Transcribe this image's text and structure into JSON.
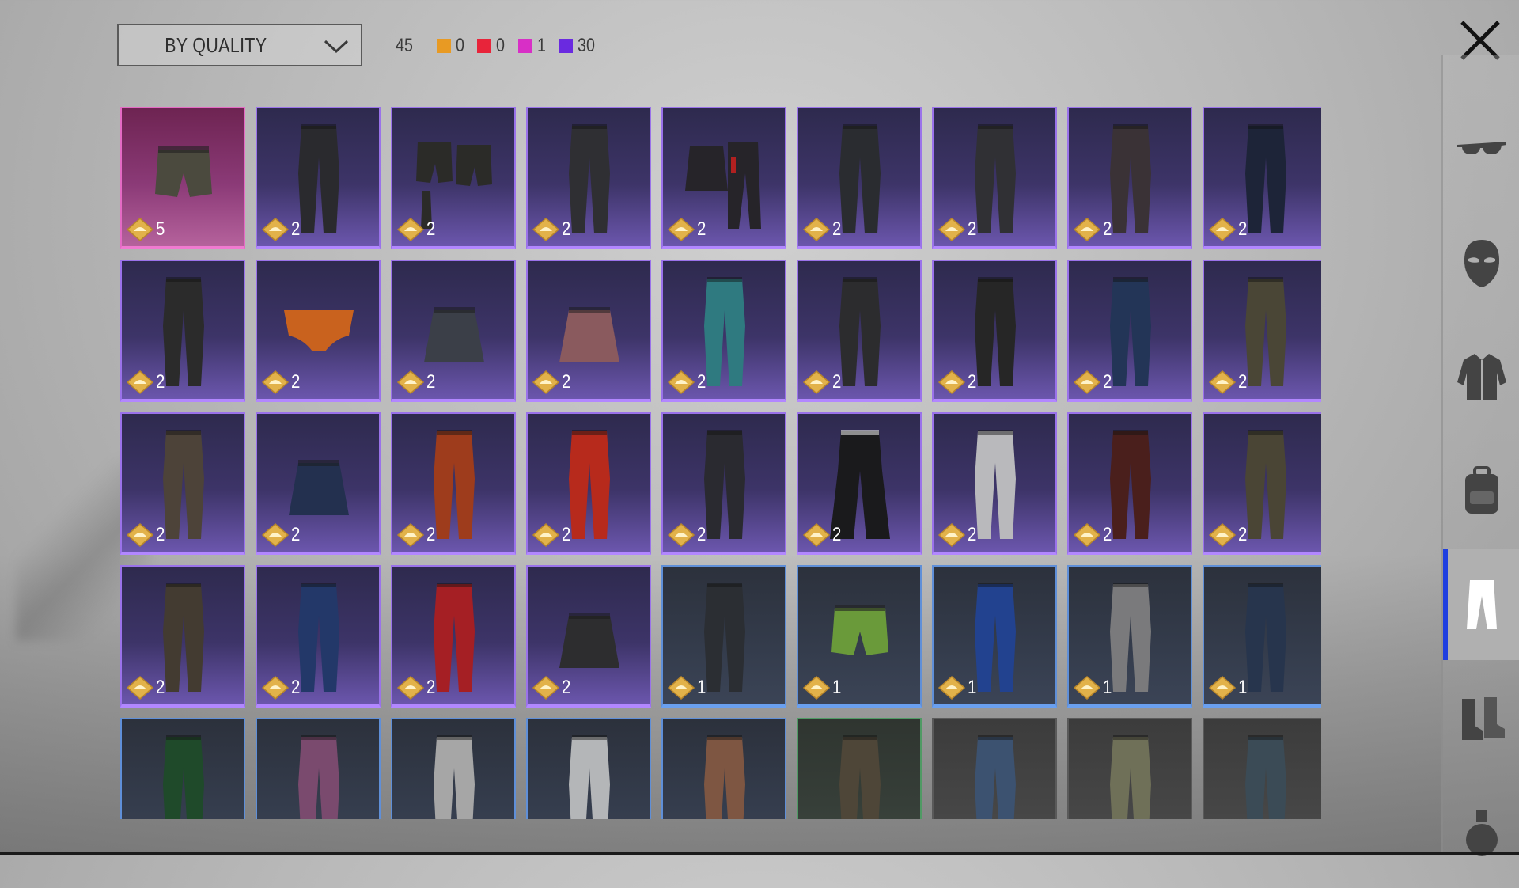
{
  "filter": {
    "label": "BY QUALITY",
    "icon": "chevron-down-icon"
  },
  "counts": {
    "total": "45",
    "by_quality": [
      {
        "color": "#e89a23",
        "count": "0"
      },
      {
        "color": "#e8243a",
        "count": "0"
      },
      {
        "color": "#d82fc6",
        "count": "1"
      },
      {
        "color": "#6a2ae0",
        "count": "30"
      }
    ]
  },
  "close_icon": "close-icon",
  "sidebar": {
    "active_color": "#1f3fe0",
    "items": [
      {
        "name": "glasses",
        "icon": "glasses-icon",
        "active": false
      },
      {
        "name": "mask",
        "icon": "mask-icon",
        "active": false
      },
      {
        "name": "jacket",
        "icon": "jacket-icon",
        "active": false
      },
      {
        "name": "backpack",
        "icon": "backpack-icon",
        "active": false
      },
      {
        "name": "pants",
        "icon": "pants-icon",
        "active": true
      },
      {
        "name": "boots",
        "icon": "boots-icon",
        "active": false
      },
      {
        "name": "grenade",
        "icon": "grenade-icon",
        "active": false
      }
    ]
  },
  "items": [
    {
      "q": "pink",
      "kind": "shorts",
      "c": "#4b4a3e",
      "count": "5"
    },
    {
      "q": "purple",
      "kind": "pants",
      "c": "#2a2a2e",
      "count": "2"
    },
    {
      "q": "purple",
      "kind": "shorts-set",
      "c": "#2b2b28",
      "count": "2"
    },
    {
      "q": "purple",
      "kind": "pants",
      "c": "#2f2f33",
      "count": "2"
    },
    {
      "q": "purple",
      "kind": "skirt-set",
      "c": "#262429",
      "count": "2"
    },
    {
      "q": "purple",
      "kind": "pants",
      "c": "#2a2c30",
      "count": "2"
    },
    {
      "q": "purple",
      "kind": "pants",
      "c": "#303034",
      "count": "2"
    },
    {
      "q": "purple",
      "kind": "pants",
      "c": "#3a3236",
      "count": "2"
    },
    {
      "q": "purple",
      "kind": "pants",
      "c": "#1d2438",
      "count": "2"
    },
    {
      "q": "purple",
      "kind": "pants",
      "c": "#2b2b2b",
      "count": "2"
    },
    {
      "q": "purple",
      "kind": "briefs",
      "c": "#c9621e",
      "count": "2"
    },
    {
      "q": "purple",
      "kind": "skirt",
      "c": "#3b3f48",
      "count": "2"
    },
    {
      "q": "purple",
      "kind": "skirt",
      "c": "#8a5a5e",
      "count": "2"
    },
    {
      "q": "purple",
      "kind": "pants",
      "c": "#2f7a80",
      "count": "2"
    },
    {
      "q": "purple",
      "kind": "pants",
      "c": "#2c2c2e",
      "count": "2"
    },
    {
      "q": "purple",
      "kind": "pants",
      "c": "#262626",
      "count": "2"
    },
    {
      "q": "purple",
      "kind": "pants",
      "c": "#233557",
      "count": "2"
    },
    {
      "q": "purple",
      "kind": "pants",
      "c": "#4a4636",
      "count": "2"
    },
    {
      "q": "purple",
      "kind": "pants",
      "c": "#4d4339",
      "count": "2"
    },
    {
      "q": "purple",
      "kind": "skirt",
      "c": "#23304f",
      "count": "2"
    },
    {
      "q": "purple",
      "kind": "pants",
      "c": "#9e3c1c",
      "count": "2"
    },
    {
      "q": "purple",
      "kind": "pants",
      "c": "#b72a1c",
      "count": "2"
    },
    {
      "q": "purple",
      "kind": "pants",
      "c": "#2a2a30",
      "count": "2"
    },
    {
      "q": "purple",
      "kind": "flares",
      "c": "#1a1a1c",
      "count": "2"
    },
    {
      "q": "purple",
      "kind": "pants",
      "c": "#b9b9bc",
      "count": "2"
    },
    {
      "q": "purple",
      "kind": "pants",
      "c": "#4a1f1c",
      "count": "2"
    },
    {
      "q": "purple",
      "kind": "pants",
      "c": "#4a4535",
      "count": "2"
    },
    {
      "q": "purple",
      "kind": "pants",
      "c": "#433b31",
      "count": "2"
    },
    {
      "q": "purple",
      "kind": "pants",
      "c": "#233869",
      "count": "2"
    },
    {
      "q": "purple",
      "kind": "pants",
      "c": "#a51f24",
      "count": "2"
    },
    {
      "q": "purple",
      "kind": "skirt",
      "c": "#2d2d2f",
      "count": "2"
    },
    {
      "q": "blue",
      "kind": "pants",
      "c": "#2b2e33",
      "count": "1"
    },
    {
      "q": "blue",
      "kind": "shorts",
      "c": "#6a9a3a",
      "count": "1"
    },
    {
      "q": "blue",
      "kind": "pants",
      "c": "#22428f",
      "count": "1"
    },
    {
      "q": "blue",
      "kind": "pants",
      "c": "#7a7a7c",
      "count": "1"
    },
    {
      "q": "blue",
      "kind": "pants",
      "c": "#27354d",
      "count": "1"
    },
    {
      "q": "blue",
      "kind": "pants",
      "c": "#1f4a2a",
      "count": ""
    },
    {
      "q": "blue",
      "kind": "pants",
      "c": "#7a4a6e",
      "count": ""
    },
    {
      "q": "blue",
      "kind": "pants",
      "c": "#a6a6a6",
      "count": ""
    },
    {
      "q": "blue",
      "kind": "pants",
      "c": "#b4b6b8",
      "count": ""
    },
    {
      "q": "blue",
      "kind": "pants",
      "c": "#7e5642",
      "count": ""
    },
    {
      "q": "green",
      "kind": "pants",
      "c": "#4e4638",
      "count": ""
    },
    {
      "q": "gray",
      "kind": "pants",
      "c": "#3c5270",
      "count": ""
    },
    {
      "q": "gray",
      "kind": "pants",
      "c": "#6f7058",
      "count": ""
    },
    {
      "q": "gray",
      "kind": "pants",
      "c": "#3b4b56",
      "count": ""
    }
  ]
}
